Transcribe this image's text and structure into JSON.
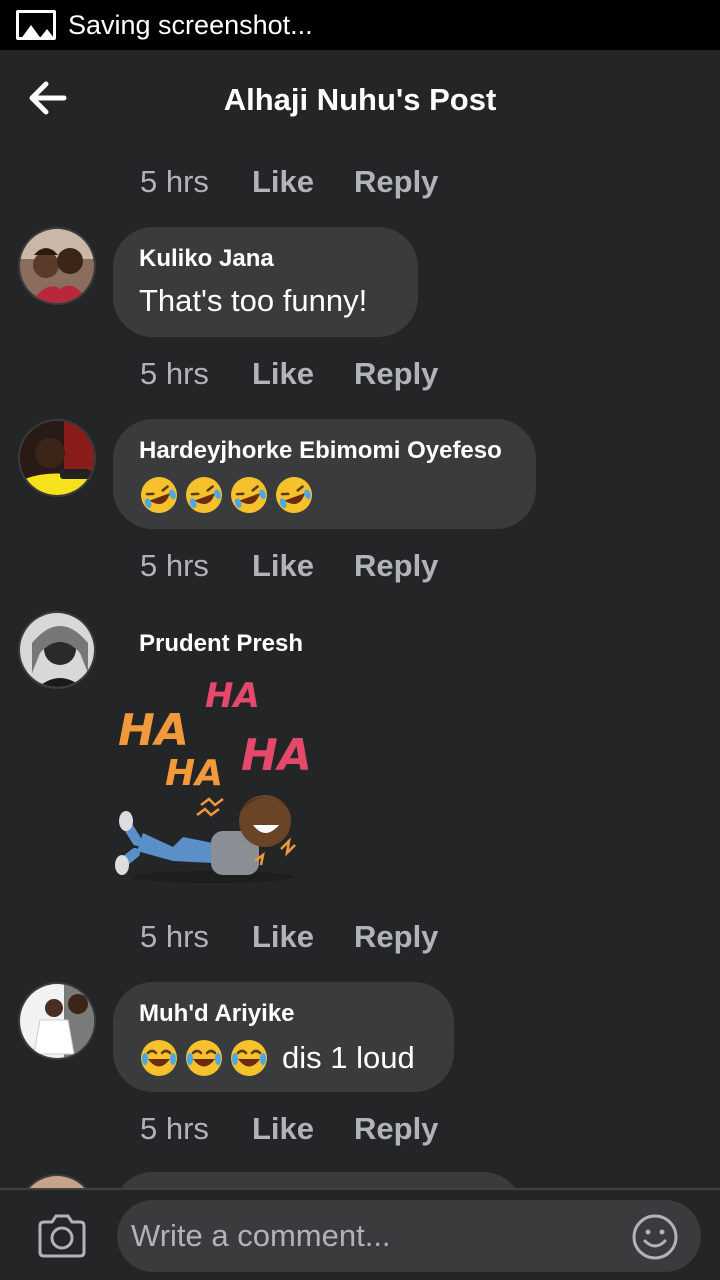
{
  "status_bar": {
    "text": "Saving screenshot..."
  },
  "header": {
    "title": "Alhaji Nuhu's Post"
  },
  "comments": [
    {
      "time": "5 hrs",
      "like": "Like",
      "reply": "Reply"
    },
    {
      "author": "Kuliko Jana",
      "text": "That's too funny!",
      "time": "5 hrs",
      "like": "Like",
      "reply": "Reply"
    },
    {
      "author": "Hardeyjhorke Ebimomi Oyefeso",
      "emojis": [
        "rolling-on-floor-laughing",
        "rolling-on-floor-laughing",
        "rolling-on-floor-laughing",
        "rolling-on-floor-laughing"
      ],
      "time": "5 hrs",
      "like": "Like",
      "reply": "Reply"
    },
    {
      "author": "Prudent Presh",
      "sticker": {
        "words": [
          "HA",
          "HA",
          "HA",
          "HA"
        ],
        "icon": "laughing-man-sticker"
      },
      "time": "5 hrs",
      "like": "Like",
      "reply": "Reply"
    },
    {
      "author": "Muh'd Ariyike",
      "emojis": [
        "face-with-tears-of-joy",
        "face-with-tears-of-joy",
        "face-with-tears-of-joy"
      ],
      "text": "dis 1 loud",
      "time": "5 hrs",
      "like": "Like",
      "reply": "Reply"
    }
  ],
  "composer": {
    "placeholder": "Write a comment...",
    "camera_icon": "camera-icon",
    "emoji_icon": "smiley-icon"
  },
  "colors": {
    "background": "#242526",
    "bubble": "#3a3b3c",
    "muted_text": "#b0b3b8",
    "sticker_orange": "#f29a3b",
    "sticker_red": "#e5486a"
  }
}
